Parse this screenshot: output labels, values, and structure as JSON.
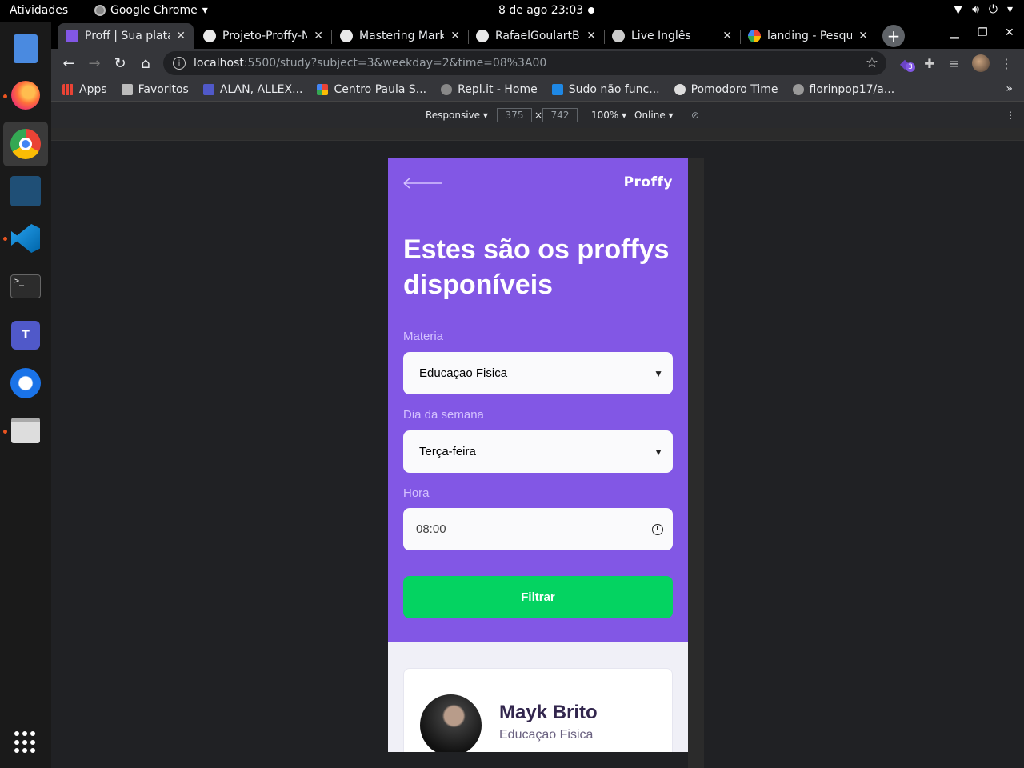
{
  "system": {
    "activities": "Atividades",
    "app_name": "Google Chrome",
    "clock": "8 de ago  23:03"
  },
  "tabs": [
    {
      "title": "Proff | Sua plata",
      "favicon": "proffy-icon",
      "active": true
    },
    {
      "title": "Projeto-Proffy-N",
      "favicon": "github-icon",
      "active": false
    },
    {
      "title": "Mastering Mark",
      "favicon": "github-icon",
      "active": false
    },
    {
      "title": "RafaelGoulartB",
      "favicon": "github-icon",
      "active": false
    },
    {
      "title": "Live Inglês",
      "favicon": "site-icon",
      "active": false
    },
    {
      "title": "landing - Pesqu",
      "favicon": "google-icon",
      "active": false
    }
  ],
  "omnibox": {
    "host": "localhost",
    "path": ":5500/study?subject=3&weekday=2&time=08%3A00"
  },
  "extensions": {
    "badge_count": "3"
  },
  "bookmarks": [
    {
      "label": "Apps",
      "icon": "apps-icon"
    },
    {
      "label": "Favoritos",
      "icon": "folder-icon"
    },
    {
      "label": "ALAN, ALLEX...",
      "icon": "teams-icon"
    },
    {
      "label": "Centro Paula S...",
      "icon": "site-icon"
    },
    {
      "label": "Repl.it - Home",
      "icon": "replit-icon"
    },
    {
      "label": "Sudo não func...",
      "icon": "site-icon"
    },
    {
      "label": "Pomodoro Time",
      "icon": "site-icon"
    },
    {
      "label": "florinpop17/a...",
      "icon": "github-icon"
    }
  ],
  "devtools": {
    "mode": "Responsive",
    "width": "375",
    "height": "742",
    "zoom": "100%",
    "network": "Online"
  },
  "page": {
    "logo": "Proffy",
    "headline": "Estes são os proffys disponíveis",
    "subject_label": "Materia",
    "subject_value": "Educaçao Fisica",
    "weekday_label": "Dia da semana",
    "weekday_value": "Terça-feira",
    "time_label": "Hora",
    "time_value": "08:00",
    "filter_button": "Filtrar",
    "colors": {
      "primary": "#8257e5",
      "button": "#04d361",
      "background": "#f0f0f7"
    },
    "teacher": {
      "name": "Mayk Brito",
      "subject": "Educaçao Fisica"
    }
  }
}
